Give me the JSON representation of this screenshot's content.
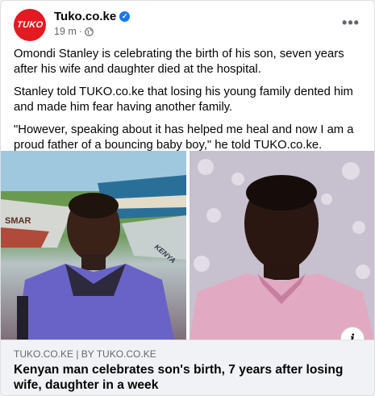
{
  "post": {
    "page_name": "Tuko.co.ke",
    "avatar_text": "TUKO",
    "time": "19 m",
    "separator": "·",
    "more_label": "•••",
    "paragraphs": [
      "Omondi Stanley is celebrating the birth of his son, seven years after his wife and daughter died at the hospital.",
      "Stanley told TUKO.co.ke that losing his young family dented him and made him fear having another family.",
      "\"However, speaking about it has helped me heal and now I am a proud father of a bouncing baby boy,\" he told TUKO.co.ke."
    ]
  },
  "photos": {
    "left_boat_text": "SMAR",
    "left_boat_text_2": "KENYA",
    "info_label": "i"
  },
  "link": {
    "source": "TUKO.CO.KE | BY TUKO.CO.KE",
    "title": "Kenyan man celebrates son's birth, 7 years after losing wife, daughter in a week"
  },
  "colors": {
    "brand_red": "#e21a22",
    "verified_blue": "#1877f2",
    "meta_grey": "#65676b"
  }
}
